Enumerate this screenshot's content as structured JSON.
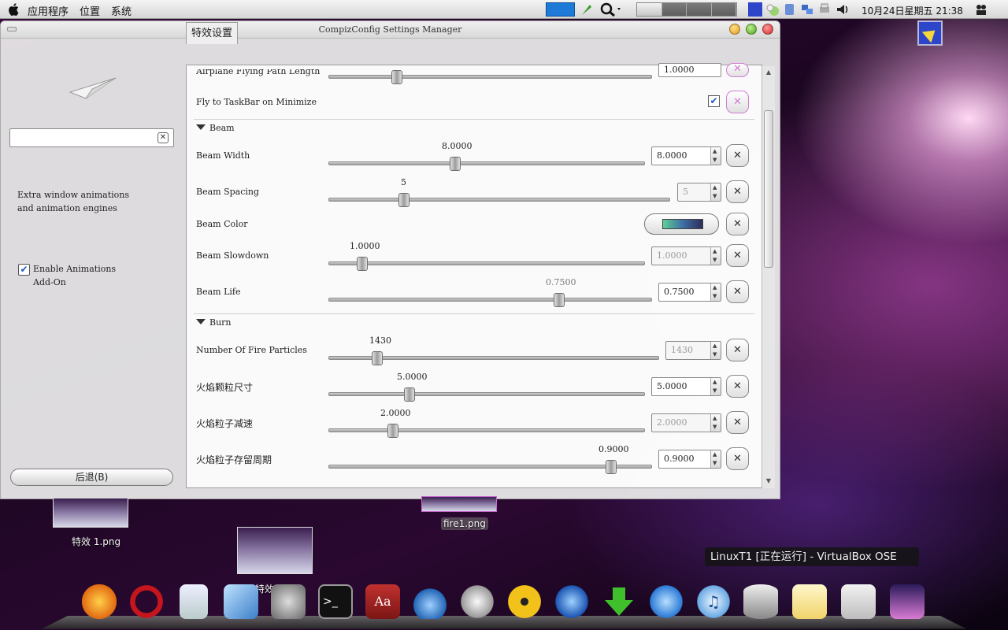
{
  "panel": {
    "menus": [
      "应用程序",
      "位置",
      "系统"
    ],
    "clock": "10月24日星期五 21:38"
  },
  "window": {
    "title": "CompizConfig Settings Manager",
    "sidebar": {
      "description": "Extra window animations and animation engines",
      "enable_label": "Enable Animations Add-On",
      "enable_checked": true,
      "back_button": "后退(B)"
    },
    "tab_label": "特效设置",
    "rows": {
      "airplane_label": "Airplane Flying Path Length",
      "airplane_value": "1.0000",
      "fly_label": "Fly to TaskBar on Minimize",
      "beam_section": "Beam",
      "beam_width_label": "Beam Width",
      "beam_width_value": "8.0000",
      "beam_spacing_label": "Beam Spacing",
      "beam_spacing_value": "5",
      "beam_color_label": "Beam Color",
      "beam_slowdown_label": "Beam Slowdown",
      "beam_slowdown_value": "1.0000",
      "beam_life_label": "Beam Life",
      "beam_life_value": "0.7500",
      "burn_section": "Burn",
      "fire_particles_label": "Number Of Fire Particles",
      "fire_particles_value": "1430",
      "particle_size_label": "火焰颗粒尺寸",
      "particle_size_value": "5.0000",
      "particle_slow_label": "火焰粒子减速",
      "particle_slow_value": "2.0000",
      "particle_life_label": "火焰粒子存留周期",
      "particle_life_value": "0.9000"
    }
  },
  "desktop": {
    "labels": [
      "特效 1.png",
      "特效5.png",
      "fire1.png"
    ],
    "tooltip": "LinuxT1 [正在运行] - VirtualBox OSE"
  },
  "dock_items": [
    "firefox-icon",
    "opera-icon",
    "ipod-icon",
    "virtualbox-icon",
    "system-prefs-icon",
    "terminal-icon",
    "dictionary-icon",
    "droplet-icon",
    "sync-icon",
    "radiation-icon",
    "network-globe-icon",
    "download-icon",
    "ichat-icon",
    "itunes-icon",
    "database-icon",
    "notes-icon",
    "tools-icon",
    "screen-icon"
  ]
}
